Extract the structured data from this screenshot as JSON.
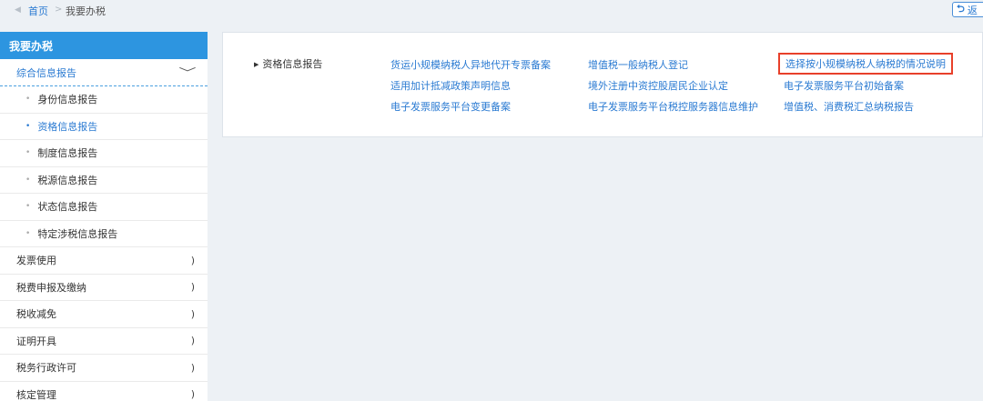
{
  "breadcrumb": {
    "home": "首页",
    "separator": ">",
    "current": "我要办税"
  },
  "back_button": {
    "label": "返"
  },
  "sidebar": {
    "title": "我要办税",
    "group": {
      "label": "综合信息报告",
      "chevron": "﹀"
    },
    "sub_items": [
      {
        "label": "身份信息报告"
      },
      {
        "label": "资格信息报告"
      },
      {
        "label": "制度信息报告"
      },
      {
        "label": "税源信息报告"
      },
      {
        "label": "状态信息报告"
      },
      {
        "label": "特定涉税信息报告"
      }
    ],
    "active_sub_index": 1,
    "top_items": [
      {
        "label": "发票使用"
      },
      {
        "label": "税费申报及缴纳"
      },
      {
        "label": "税收减免"
      },
      {
        "label": "证明开具"
      },
      {
        "label": "税务行政许可"
      },
      {
        "label": "核定管理"
      }
    ],
    "arrow": ")"
  },
  "content": {
    "category": "资格信息报告",
    "links": {
      "col1": [
        "货运小规模纳税人异地代开专票备案",
        "适用加计抵减政策声明信息",
        "电子发票服务平台变更备案"
      ],
      "col2": [
        "增值税一般纳税人登记",
        "境外注册中资控股居民企业认定",
        "电子发票服务平台税控服务器信息维护"
      ],
      "col3": [
        "选择按小规模纳税人纳税的情况说明",
        "电子发票服务平台初始备案",
        "增值税、消费税汇总纳税报告"
      ]
    },
    "highlight_color": "#e8402a"
  }
}
